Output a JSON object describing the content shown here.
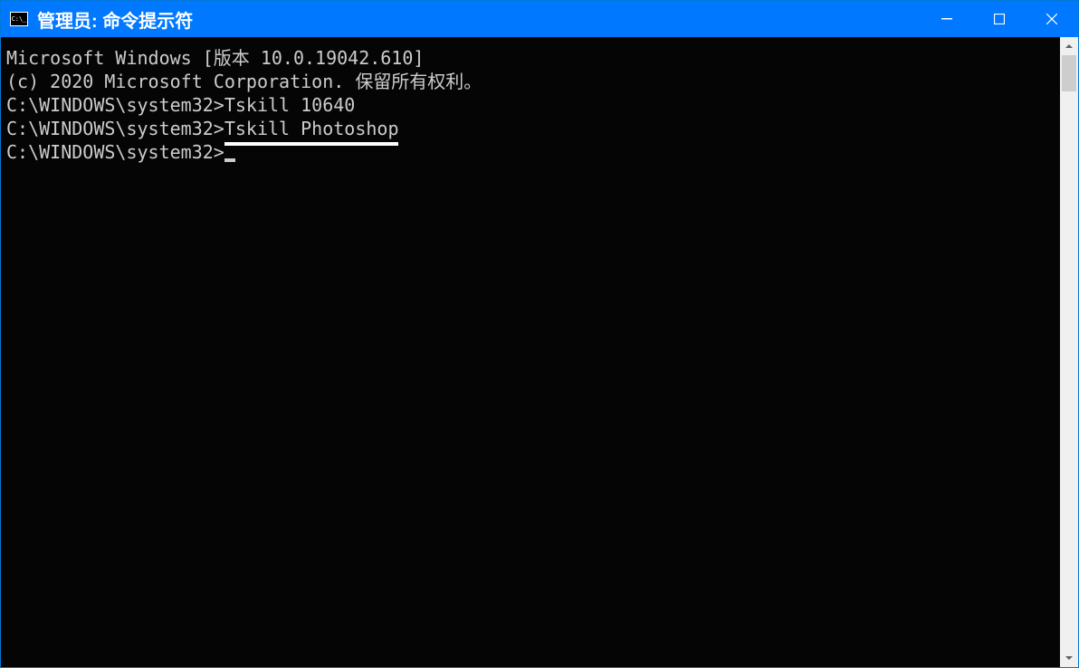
{
  "window": {
    "title": "管理员: 命令提示符"
  },
  "console": {
    "line1": "Microsoft Windows [版本 10.0.19042.610]",
    "line2": "(c) 2020 Microsoft Corporation. 保留所有权利。",
    "blank1": "",
    "prompt1_path": "C:\\WINDOWS\\system32>",
    "prompt1_cmd": "Tskill 10640",
    "blank2": "",
    "prompt2_path": "C:\\WINDOWS\\system32>",
    "prompt2_cmd": "Tskill Photoshop",
    "blank3": "",
    "prompt3_path": "C:\\WINDOWS\\system32>"
  }
}
